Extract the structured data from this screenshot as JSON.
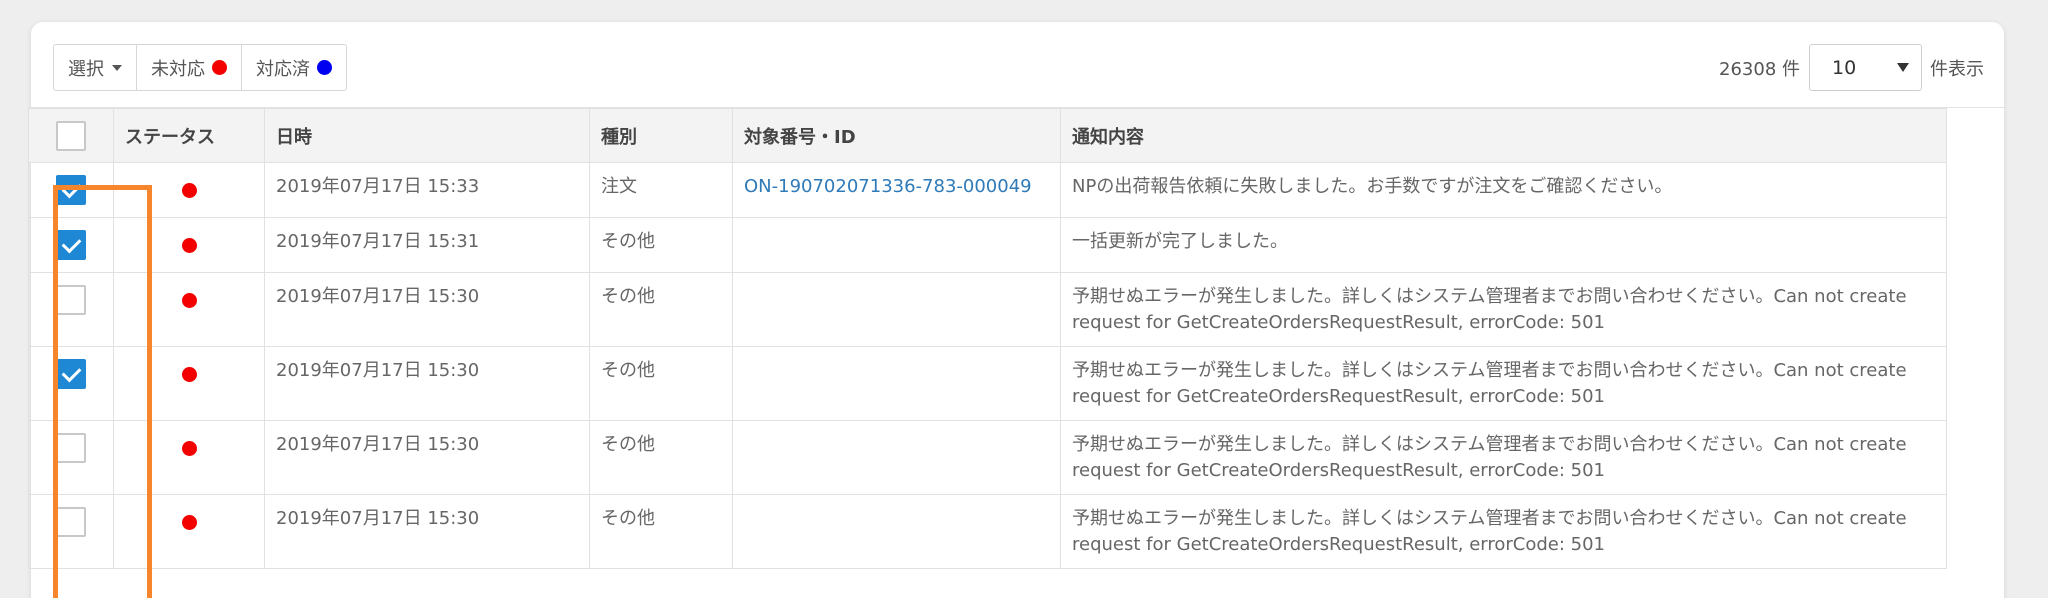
{
  "toolbar": {
    "select_label": "選択",
    "unhandled_label": "未対応",
    "handled_label": "対応済",
    "count_text": "26308 件",
    "per_page_value": "10",
    "per_page_suffix": "件表示"
  },
  "colors": {
    "unhandled_dot": "#f30000",
    "handled_dot": "#0000f0",
    "checkbox_checked": "#1e88d5",
    "link": "#2f7ab8",
    "highlight_border": "#f7852b"
  },
  "table": {
    "headers": [
      "",
      "ステータス",
      "日時",
      "種別",
      "対象番号・ID",
      "通知内容"
    ],
    "rows": [
      {
        "checked": true,
        "status": "unhandled",
        "datetime": "2019年07月17日 15:33",
        "type": "注文",
        "target_id": "ON-190702071336-783-000049",
        "message": "NPの出荷報告依頼に失敗しました。お手数ですが注文をご確認ください。"
      },
      {
        "checked": true,
        "status": "unhandled",
        "datetime": "2019年07月17日 15:31",
        "type": "その他",
        "target_id": "",
        "message": "一括更新が完了しました。"
      },
      {
        "checked": false,
        "status": "unhandled",
        "datetime": "2019年07月17日 15:30",
        "type": "その他",
        "target_id": "",
        "message": "予期せぬエラーが発生しました。詳しくはシステム管理者までお問い合わせください。Can not create request for GetCreateOrdersRequestResult, errorCode: 501"
      },
      {
        "checked": true,
        "status": "unhandled",
        "datetime": "2019年07月17日 15:30",
        "type": "その他",
        "target_id": "",
        "message": "予期せぬエラーが発生しました。詳しくはシステム管理者までお問い合わせください。Can not create request for GetCreateOrdersRequestResult, errorCode: 501"
      },
      {
        "checked": false,
        "status": "unhandled",
        "datetime": "2019年07月17日 15:30",
        "type": "その他",
        "target_id": "",
        "message": "予期せぬエラーが発生しました。詳しくはシステム管理者までお問い合わせください。Can not create request for GetCreateOrdersRequestResult, errorCode: 501"
      },
      {
        "checked": false,
        "status": "unhandled",
        "datetime": "2019年07月17日 15:30",
        "type": "その他",
        "target_id": "",
        "message": "予期せぬエラーが発生しました。詳しくはシステム管理者までお問い合わせください。Can not create request for GetCreateOrdersRequestResult, errorCode: 501"
      }
    ]
  }
}
